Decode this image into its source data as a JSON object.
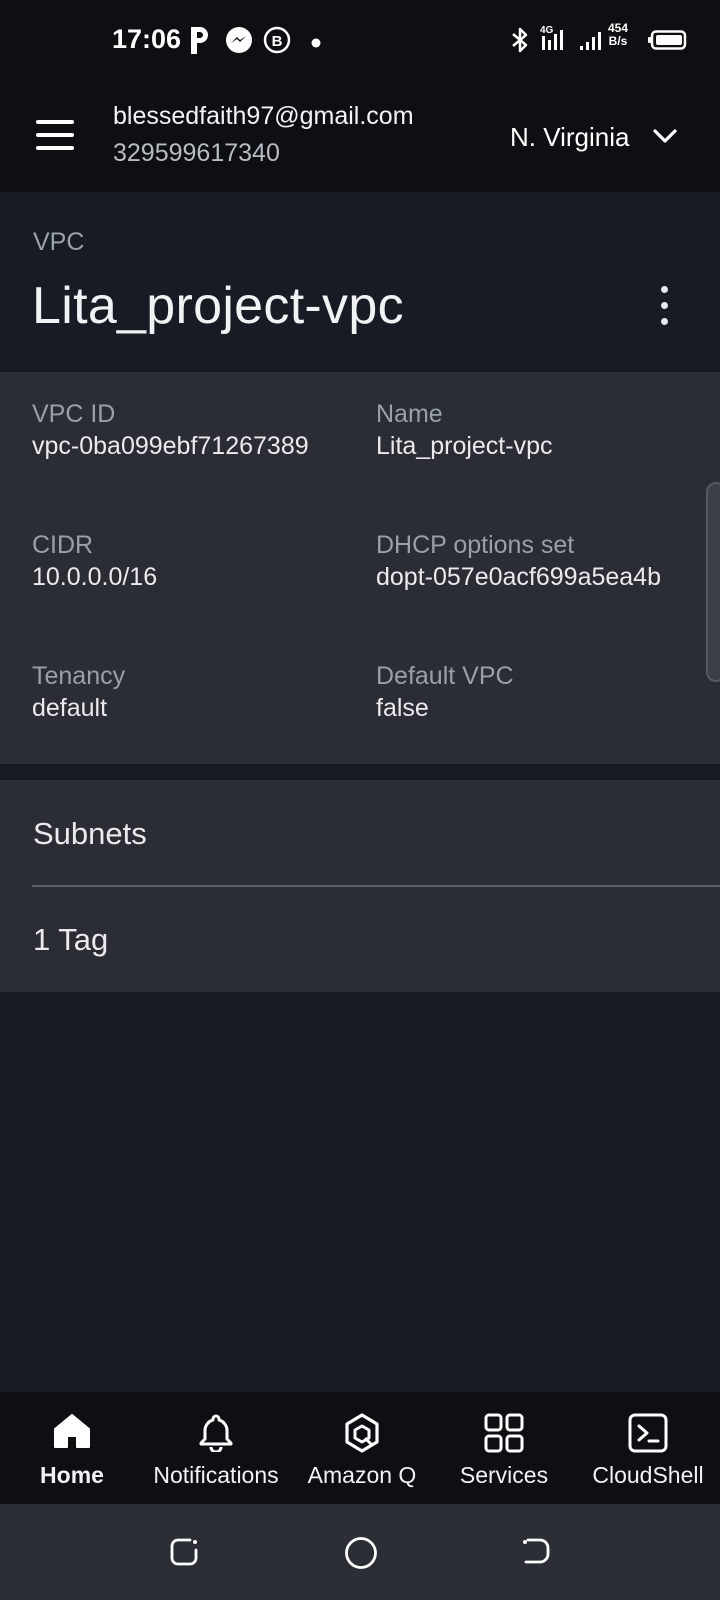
{
  "status_bar": {
    "time": "17:06",
    "net_speed_value": "454",
    "net_speed_unit": "B/s",
    "network_type": "4G",
    "icons": [
      "parking-icon",
      "messenger-icon",
      "b-icon",
      "dot-icon",
      "bluetooth-icon",
      "signal-icon",
      "battery-icon"
    ]
  },
  "header": {
    "email": "blessedfaith97@gmail.com",
    "account_id": "329599617340",
    "region": "N. Virginia"
  },
  "title": {
    "kicker": "VPC",
    "name": "Lita_project-vpc"
  },
  "details": {
    "vpc_id": {
      "label": "VPC ID",
      "value": "vpc-0ba099ebf71267389"
    },
    "name": {
      "label": "Name",
      "value": "Lita_project-vpc"
    },
    "cidr": {
      "label": "CIDR",
      "value": "10.0.0.0/16"
    },
    "dhcp": {
      "label": "DHCP options set",
      "value": "dopt-057e0acf699a5ea4b"
    },
    "tenancy": {
      "label": "Tenancy",
      "value": "default"
    },
    "default_vpc": {
      "label": "Default VPC",
      "value": "false"
    }
  },
  "sections": [
    {
      "label": "Subnets"
    },
    {
      "label": "1 Tag"
    }
  ],
  "bottom_nav": {
    "active": "Home",
    "items": [
      {
        "label": "Home",
        "icon": "home-icon"
      },
      {
        "label": "Notifications",
        "icon": "bell-icon"
      },
      {
        "label": "Amazon Q",
        "icon": "amazon-q-icon"
      },
      {
        "label": "Services",
        "icon": "grid-icon"
      },
      {
        "label": "CloudShell",
        "icon": "terminal-icon"
      }
    ]
  },
  "colors": {
    "background": "#161a22",
    "header": "#0d0f12",
    "panel": "#2a2d33",
    "label": "#98a0a8",
    "text": "#e9ebee"
  }
}
